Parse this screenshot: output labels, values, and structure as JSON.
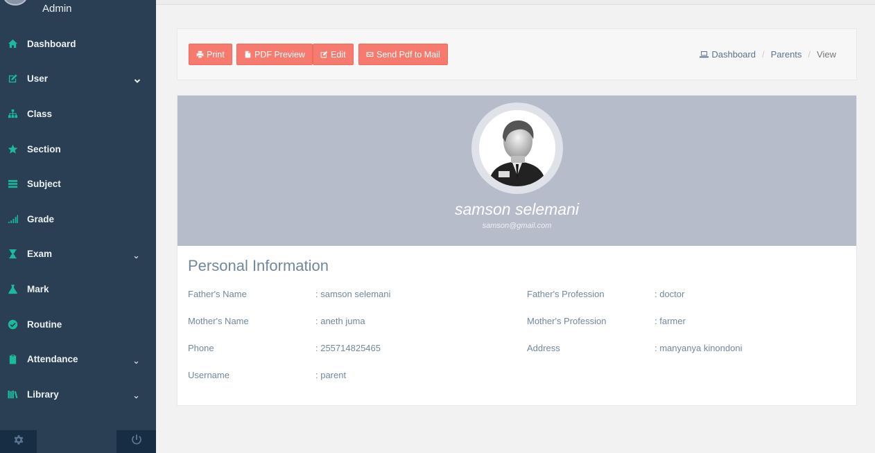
{
  "sidebar": {
    "user_name": "Admin",
    "items": [
      {
        "label": "Dashboard",
        "icon": "home-icon",
        "chevron": "none"
      },
      {
        "label": "User",
        "icon": "edit-icon",
        "chevron": "large"
      },
      {
        "label": "Class",
        "icon": "sitemap-icon",
        "chevron": "none"
      },
      {
        "label": "Section",
        "icon": "star-icon",
        "chevron": "none"
      },
      {
        "label": "Subject",
        "icon": "book-icon",
        "chevron": "none"
      },
      {
        "label": "Grade",
        "icon": "signal-icon",
        "chevron": "none"
      },
      {
        "label": "Exam",
        "icon": "hourglass-icon",
        "chevron": "small"
      },
      {
        "label": "Mark",
        "icon": "flask-icon",
        "chevron": "none"
      },
      {
        "label": "Routine",
        "icon": "check-circle-icon",
        "chevron": "none"
      },
      {
        "label": "Attendance",
        "icon": "clipboard-icon",
        "chevron": "small"
      },
      {
        "label": "Library",
        "icon": "books-icon",
        "chevron": "small"
      }
    ]
  },
  "toolbar": {
    "buttons": [
      {
        "label": "Print",
        "icon": "print-icon"
      },
      {
        "label": "PDF Preview",
        "icon": "file-icon"
      },
      {
        "label": "Edit",
        "icon": "edit-icon"
      },
      {
        "label": "Send Pdf to Mail",
        "icon": "envelope-icon"
      }
    ],
    "breadcrumb": {
      "dashboard": "Dashboard",
      "parents": "Parents",
      "current": "View",
      "separator": "/"
    }
  },
  "profile": {
    "name": "samson selemani",
    "email": "samson@gmail.com"
  },
  "personal_info": {
    "title": "Personal Information",
    "left": [
      {
        "label": "Father's Name",
        "value": ": samson selemani"
      },
      {
        "label": "Mother's Name",
        "value": ": aneth juma"
      },
      {
        "label": "Phone",
        "value": ": 255714825465"
      },
      {
        "label": "Username",
        "value": ": parent"
      }
    ],
    "right": [
      {
        "label": "Father's Profession",
        "value": ": doctor"
      },
      {
        "label": "Mother's Profession",
        "value": ": farmer"
      },
      {
        "label": "Address",
        "value": ": manyanya kinondoni"
      }
    ]
  },
  "colors": {
    "sidebar_bg": "#2a3f54",
    "accent_icon": "#1abb9c",
    "button_bg": "#f77a6e",
    "cover_bg": "#b7bcca"
  }
}
